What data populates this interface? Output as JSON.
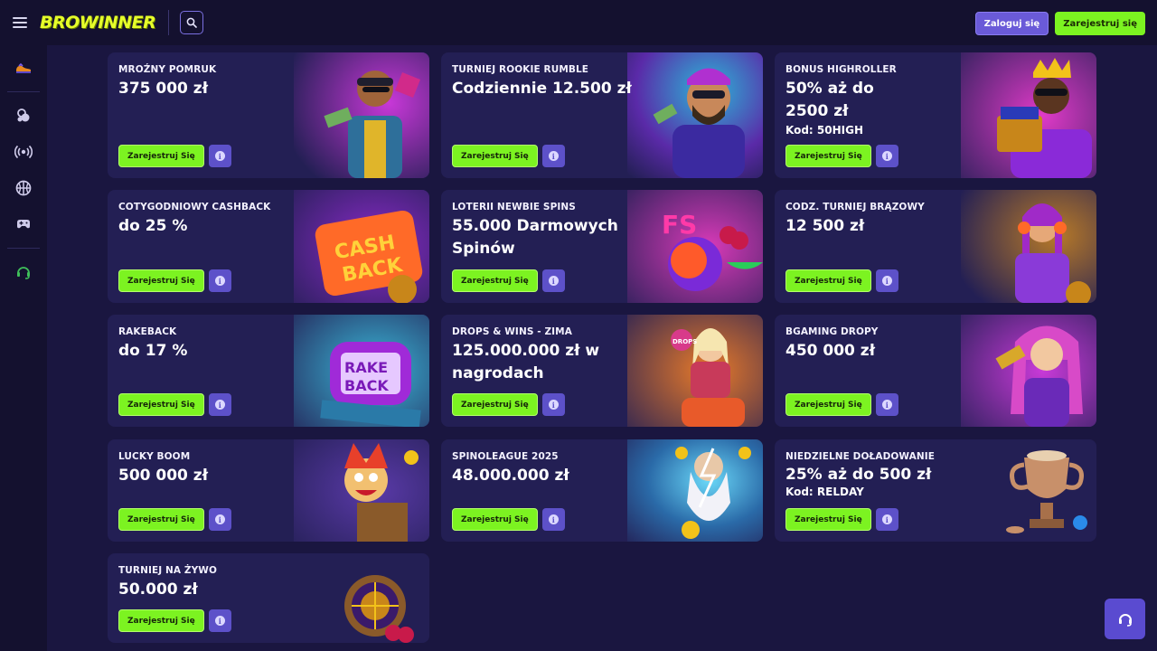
{
  "header": {
    "logo": "BROWINNER",
    "login_label": "Zaloguj się",
    "register_label": "Zarejestruj się"
  },
  "sidebar": {
    "items": [
      {
        "icon": "sneaker-icon"
      },
      {
        "icon": "casino-chips-icon"
      },
      {
        "icon": "live-broadcast-icon"
      },
      {
        "icon": "basketball-icon"
      },
      {
        "icon": "gamepad-icon"
      },
      {
        "icon": "headset-support-icon"
      }
    ]
  },
  "promos": [
    {
      "category": "MROŹNY POMRUK",
      "amount": "375 000 zł",
      "code": "",
      "button": "Zarejestruj Się",
      "art": "man-with-cash-bonus"
    },
    {
      "category": "TURNIEJ ROOKIE RUMBLE",
      "amount": "Codziennie 12.500 zł",
      "code": "",
      "button": "Zarejestruj Się",
      "art": "bearded-man-money"
    },
    {
      "category": "BONUS HIGHROLLER",
      "amount": "50% aż do 2500 zł",
      "code": "Kod: 50HIGH",
      "button": "Zarejestruj Się",
      "art": "king-treasure-chest"
    },
    {
      "category": "COTYGODNIOWY CASHBACK",
      "amount": "do 25 %",
      "code": "",
      "button": "Zarejestruj Się",
      "art": "cash-back-sign"
    },
    {
      "category": "LOTERII NEWBIE SPINS",
      "amount": "55.000 Darmowych Spinów",
      "code": "",
      "button": "Zarejestruj Się",
      "art": "fruits-fs"
    },
    {
      "category": "CODZ. TURNIEJ BRĄZOWY",
      "amount": "12 500 zł",
      "code": "",
      "button": "Zarejestruj Się",
      "art": "girl-headphones"
    },
    {
      "category": "RAKEBACK",
      "amount": "do 17 %",
      "code": "",
      "button": "Zarejestruj Się",
      "art": "rake-back-slot"
    },
    {
      "category": "DROPS & WINS - ZIMA",
      "amount": "125.000.000 zł w nagrodach",
      "code": "",
      "button": "Zarejestruj Się",
      "art": "drops-wins-biker"
    },
    {
      "category": "BGAMING DROPY",
      "amount": "450 000 zł",
      "code": "",
      "button": "Zarejestruj Się",
      "art": "pink-hair-girl"
    },
    {
      "category": "LUCKY BOOM",
      "amount": "500 000 zł",
      "code": "",
      "button": "Zarejestruj Się",
      "art": "jester-box"
    },
    {
      "category": "SPINOLEAGUE 2025",
      "amount": "48.000.000 zł",
      "code": "",
      "button": "Zarejestruj Się",
      "art": "zeus-lightning"
    },
    {
      "category": "NIEDZIELNE DOŁADOWANIE",
      "amount": "25% aż do 500 zł",
      "code": "Kod: RELDAY",
      "button": "Zarejestruj Się",
      "art": "trophy-coins"
    },
    {
      "category": "TURNIEJ NA ŻYWO",
      "amount": "50.000 zł",
      "code": "",
      "button": "Zarejestruj Się",
      "art": "roulette-wheel"
    }
  ],
  "info_glyph": "i",
  "colors": {
    "accent_green": "#7cf321",
    "accent_purple": "#6a5ad8",
    "background": "#1a1640",
    "card": "#231f54",
    "logo": "#e6ff2a"
  }
}
